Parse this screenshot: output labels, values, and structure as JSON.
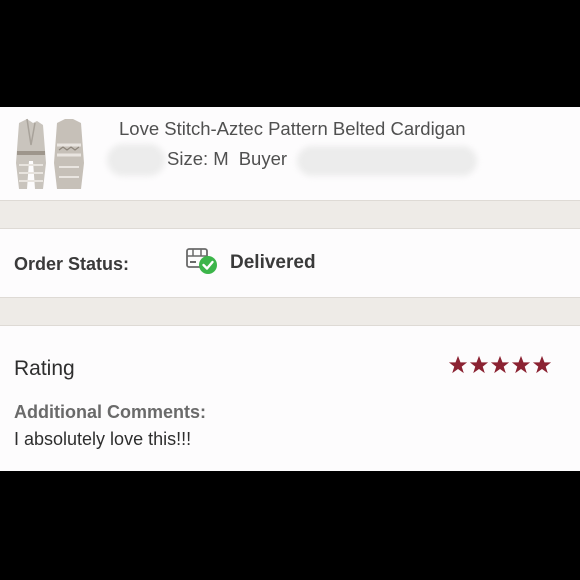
{
  "product": {
    "title": "Love Stitch-Aztec Pattern Belted Cardigan",
    "size": "Size: M",
    "buyer_label": "Buyer"
  },
  "order_status": {
    "label": "Order Status:",
    "value": "Delivered",
    "icon": "package-delivered-icon",
    "check_color": "#3cb54a"
  },
  "rating": {
    "title": "Rating",
    "stars": 5,
    "max_stars": 5,
    "star_color": "#8b2232"
  },
  "comments": {
    "label": "Additional Comments:",
    "text": "I absolutely love this!!!"
  }
}
